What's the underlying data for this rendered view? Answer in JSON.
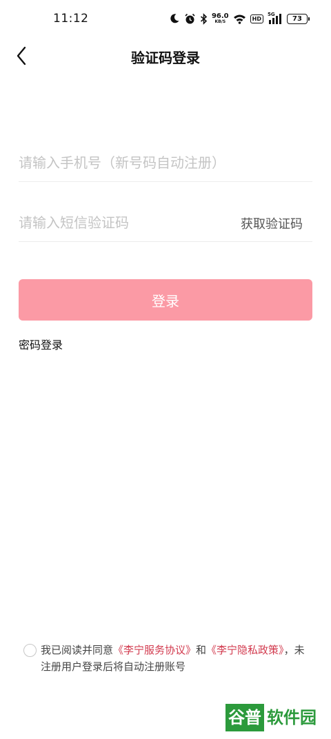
{
  "status_bar": {
    "time": "11:12",
    "net_speed_value": "96.0",
    "net_speed_unit": "KB/S",
    "hd_label": "HD",
    "network_type": "5G",
    "battery_level": "73",
    "icons": [
      "moon-icon",
      "alarm-icon",
      "bluetooth-icon",
      "wifi-icon",
      "signal-icon",
      "battery-icon"
    ]
  },
  "header": {
    "title": "验证码登录",
    "back_icon": "chevron-left-icon"
  },
  "form": {
    "phone_placeholder": "请输入手机号（新号码自动注册）",
    "phone_value": "",
    "code_placeholder": "请输入短信验证码",
    "code_value": "",
    "get_code_label": "获取验证码",
    "login_label": "登录",
    "password_login_label": "密码登录"
  },
  "agreement": {
    "checked": false,
    "prefix": "我已阅读并同意",
    "service_link": "《李宁服务协议》",
    "and": "和",
    "privacy_link": "《李宁隐私政策》",
    "suffix": "，未注册用户登录后将自动注册账号"
  },
  "watermark": {
    "badge": "谷普",
    "text": "软件园"
  },
  "colors": {
    "login_button": "#fb9aa5",
    "link": "#d23a4e",
    "placeholder": "#c4c4c4",
    "divider": "#ececec",
    "watermark_green": "#2c9a3c"
  }
}
